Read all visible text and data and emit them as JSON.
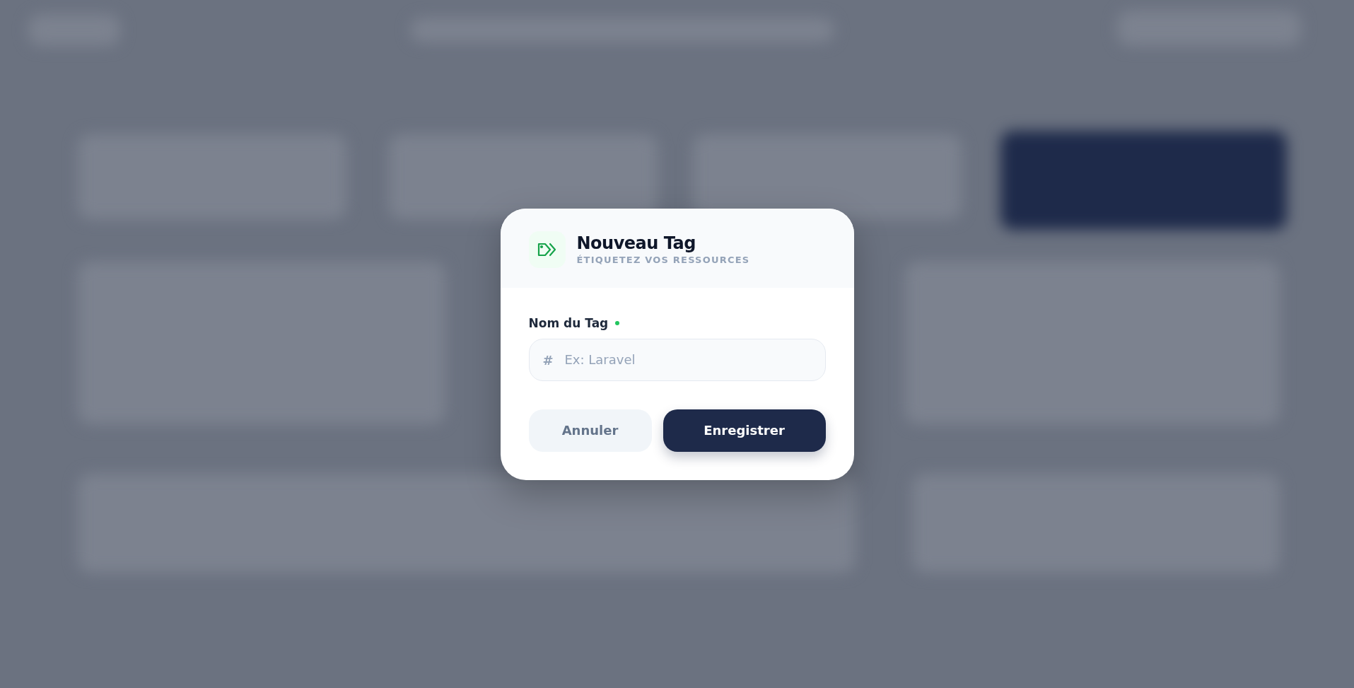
{
  "dialog": {
    "title": "Nouveau Tag",
    "subtitle": "ÉTIQUETEZ VOS RESSOURCES",
    "field": {
      "label": "Nom du Tag",
      "required": true,
      "prefix": "#",
      "placeholder": "Ex: Laravel"
    },
    "buttons": [
      {
        "label": "Annuler",
        "kind": "secondary"
      },
      {
        "label": "Enregistrer",
        "kind": "primary"
      }
    ]
  }
}
